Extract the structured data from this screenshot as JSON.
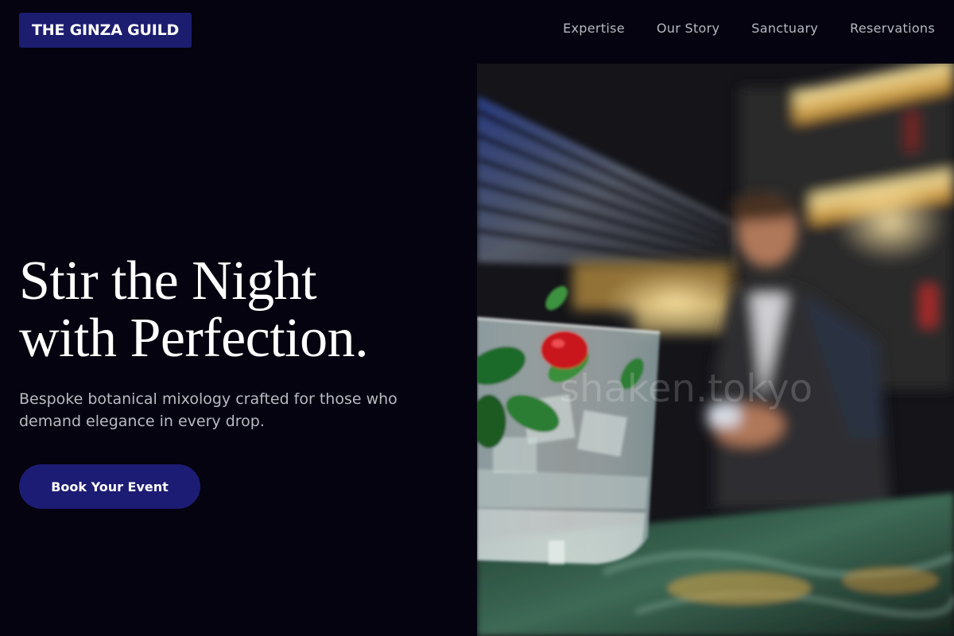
{
  "brand": {
    "name": "THE GINZA GUILD"
  },
  "nav": {
    "items": [
      {
        "label": "Expertise"
      },
      {
        "label": "Our Story"
      },
      {
        "label": "Sanctuary"
      },
      {
        "label": "Reservations"
      }
    ]
  },
  "hero": {
    "headline_line1": "Stir the Night",
    "headline_line2": "with Perfection.",
    "subtext": "Bespoke botanical mixology crafted for those who demand elegance in every drop.",
    "cta_label": "Book Your Event"
  },
  "photo": {
    "watermark": "shaken.tokyo",
    "subject": "cocktail-glass-and-bartender"
  },
  "colors": {
    "background": "#04030f",
    "accent": "#1c1d6f",
    "nav_text": "#b6b8c2",
    "subtext": "#b9bac3"
  }
}
